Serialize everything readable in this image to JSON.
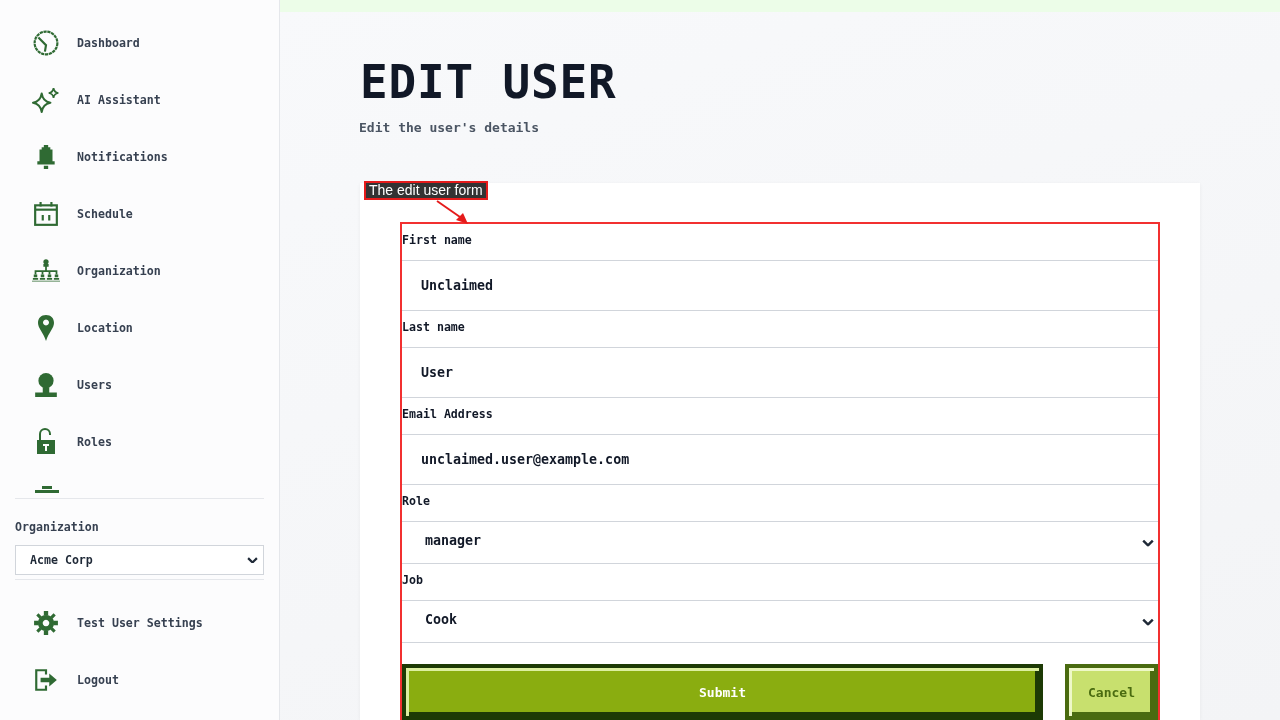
{
  "sidebar": {
    "nav_items": [
      {
        "label": "Dashboard"
      },
      {
        "label": "AI Assistant"
      },
      {
        "label": "Notifications"
      },
      {
        "label": "Schedule"
      },
      {
        "label": "Organization"
      },
      {
        "label": "Location"
      },
      {
        "label": "Users"
      },
      {
        "label": "Roles"
      }
    ],
    "organization": {
      "label": "Organization",
      "value": "Acme Corp"
    },
    "footer_items": [
      {
        "label": "Test User Settings"
      },
      {
        "label": "Logout"
      }
    ]
  },
  "page": {
    "title": "EDIT USER",
    "subtitle": "Edit the user's details"
  },
  "annotation": {
    "label": "The edit user form"
  },
  "form": {
    "fields": [
      {
        "kind": "text",
        "label": "First name",
        "value": "Unclaimed"
      },
      {
        "kind": "text",
        "label": "Last name",
        "value": "User"
      },
      {
        "kind": "text",
        "label": "Email Address",
        "value": "unclaimed.user@example.com"
      },
      {
        "kind": "select",
        "label": "Role",
        "value": "manager"
      },
      {
        "kind": "select",
        "label": "Job",
        "value": "Cook"
      }
    ],
    "buttons": [
      {
        "kind": "primary",
        "label": "Submit"
      },
      {
        "kind": "secondary",
        "label": "Cancel"
      }
    ]
  }
}
